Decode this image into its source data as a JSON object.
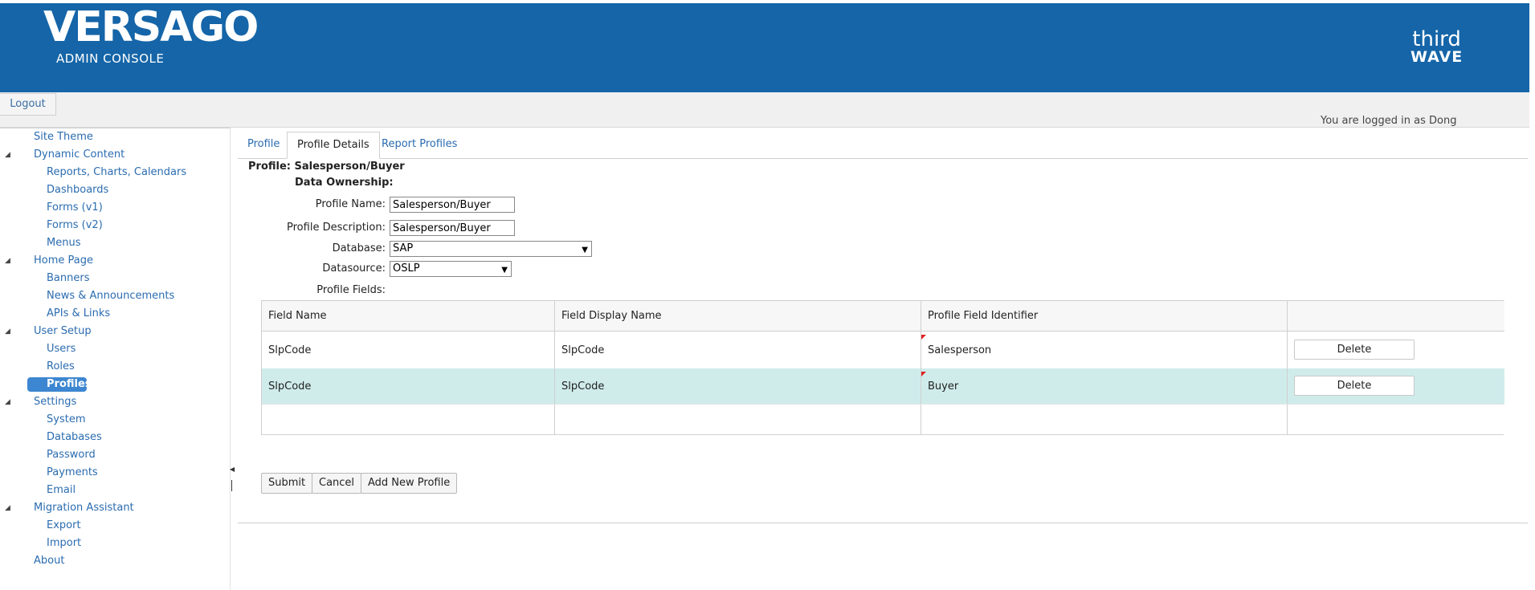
{
  "header": {
    "logo": "VERSAGO",
    "subtitle": "ADMIN CONSOLE",
    "brand_line1": "third",
    "brand_line2": "WAVE",
    "bg_color": "#1565a8"
  },
  "toolbar": {
    "logout_label": "Logout"
  },
  "status": {
    "logged_in": "You are logged in as Dong"
  },
  "sidebar": {
    "items": [
      {
        "label": "Site Theme"
      },
      {
        "label": "Dynamic Content"
      },
      {
        "label": "Reports, Charts, Calendars"
      },
      {
        "label": "Dashboards"
      },
      {
        "label": "Forms (v1)"
      },
      {
        "label": "Forms (v2)"
      },
      {
        "label": "Menus"
      },
      {
        "label": "Home Page"
      },
      {
        "label": "Banners"
      },
      {
        "label": "News & Announcements"
      },
      {
        "label": "APIs & Links"
      },
      {
        "label": "User Setup"
      },
      {
        "label": "Users"
      },
      {
        "label": "Roles"
      },
      {
        "label": "Profiles"
      },
      {
        "label": "Settings"
      },
      {
        "label": "System"
      },
      {
        "label": "Databases"
      },
      {
        "label": "Password"
      },
      {
        "label": "Payments"
      },
      {
        "label": "Email"
      },
      {
        "label": "Migration Assistant"
      },
      {
        "label": "Export"
      },
      {
        "label": "Import"
      },
      {
        "label": "About"
      }
    ],
    "active_item": "Profiles"
  },
  "tabs": [
    {
      "label": "Profile"
    },
    {
      "label": "Profile Details"
    },
    {
      "label": "Report Profiles"
    }
  ],
  "form": {
    "title": "Profile: Salesperson/Buyer",
    "data_ownership_label": "Data Ownership:",
    "profile_name_label": "Profile Name:",
    "profile_name_value": "Salesperson/Buyer",
    "profile_desc_label": "Profile Description:",
    "profile_desc_value": "Salesperson/Buyer",
    "database_label": "Database:",
    "database_value": "SAP",
    "datasource_label": "Datasource:",
    "datasource_value": "OSLP",
    "profile_fields_label": "Profile Fields:"
  },
  "grid": {
    "headers": [
      "Field Name",
      "Field Display Name",
      "Profile Field Identifier",
      ""
    ],
    "rows": [
      {
        "field_name": "SlpCode",
        "display_name": "SlpCode",
        "identifier": "Salesperson",
        "action": "Delete"
      },
      {
        "field_name": "SlpCode",
        "display_name": "SlpCode",
        "identifier": "Buyer",
        "action": "Delete"
      }
    ],
    "selected_row_color": "#cfeceb"
  },
  "buttons": {
    "submit": "Submit",
    "cancel": "Cancel",
    "add_new": "Add New Profile"
  }
}
